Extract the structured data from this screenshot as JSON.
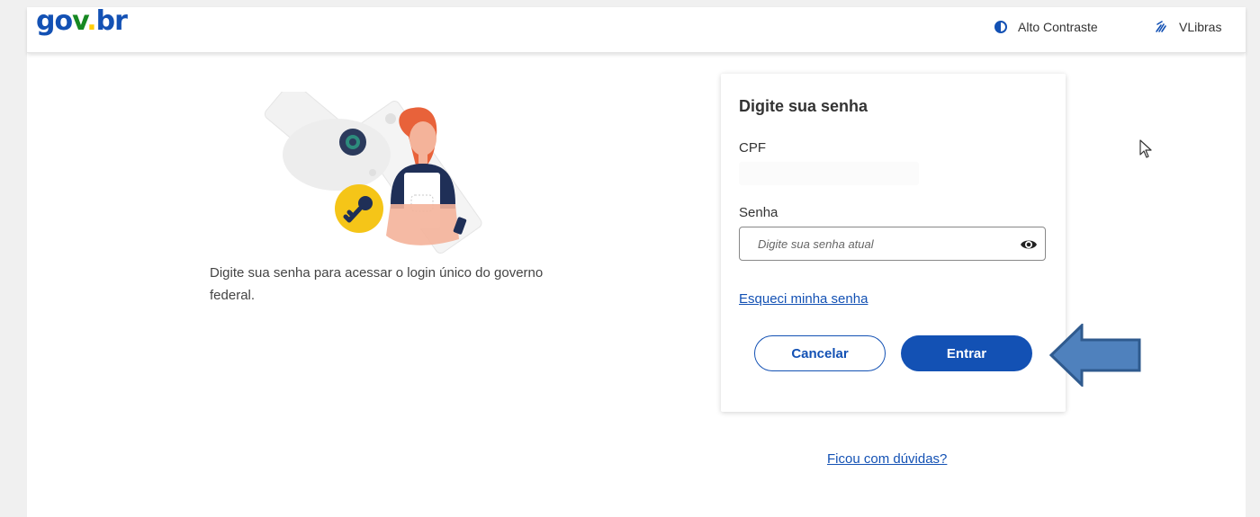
{
  "header": {
    "logo_parts": {
      "g": "g",
      "o": "o",
      "v": "v",
      "dot": ".",
      "b": "b",
      "r": "r"
    },
    "contrast_label": "Alto Contraste",
    "contrast_icon": "contrast-icon",
    "libras_label": "VLibras",
    "libras_icon": "hand-sign-icon"
  },
  "intro": {
    "text": "Digite sua senha para acessar o login único do governo federal."
  },
  "card": {
    "title": "Digite sua senha",
    "cpf_label": "CPF",
    "cpf_value": "",
    "senha_label": "Senha",
    "senha_placeholder": "Digite sua senha atual",
    "eye_icon": "eye-icon",
    "forgot_link": "Esqueci minha senha",
    "cancel_button": "Cancelar",
    "enter_button": "Entrar"
  },
  "footer": {
    "help_link": "Ficou com dúvidas?"
  },
  "annotation": {
    "arrow_icon": "left-arrow-icon",
    "arrow_color": "#4f81bd"
  },
  "colors": {
    "brand_blue": "#1351b4",
    "brand_green": "#168821",
    "brand_yellow": "#ffcd07"
  }
}
